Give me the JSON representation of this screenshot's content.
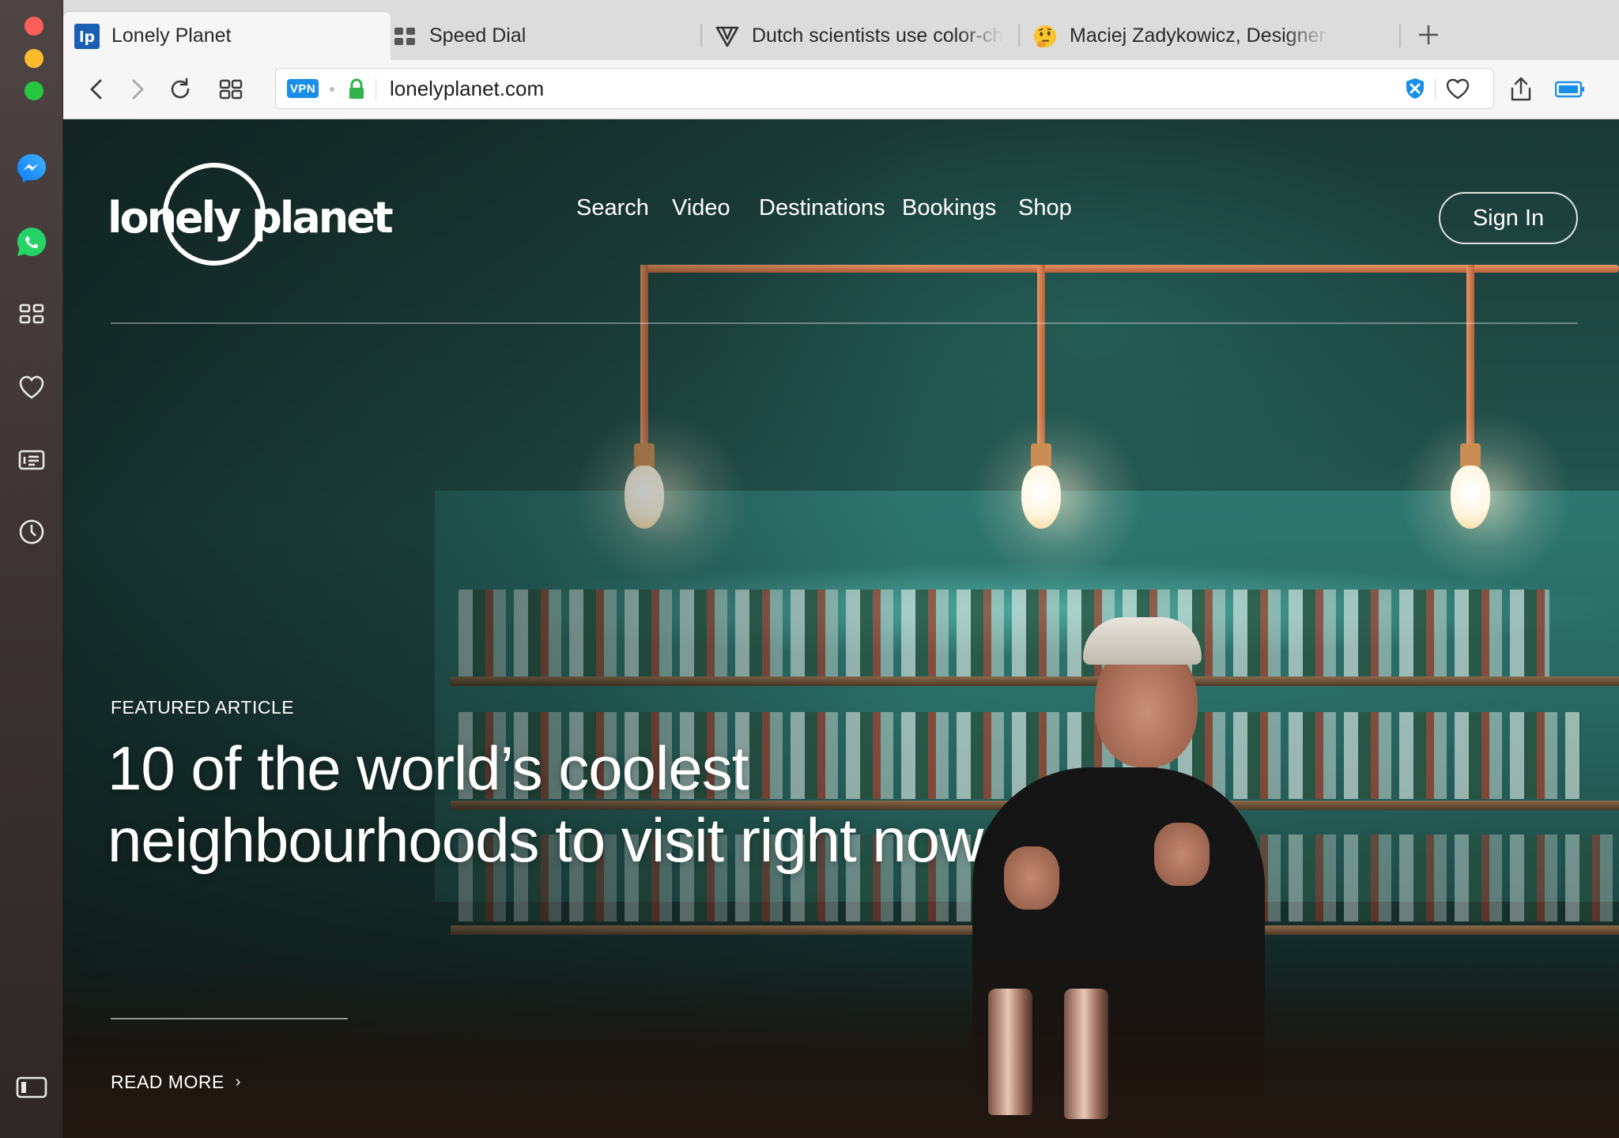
{
  "browser": {
    "tabs": [
      {
        "title": "Lonely Planet",
        "favicon": "lonely-planet-favicon",
        "active": true
      },
      {
        "title": "Speed Dial",
        "favicon": "speed-dial-favicon",
        "active": false
      },
      {
        "title": "Dutch scientists use color-ch",
        "favicon": "verge-favicon",
        "active": false
      },
      {
        "title": "Maciej Zadykowicz, Designer",
        "favicon": "thinking-face-emoji",
        "active": false
      }
    ],
    "favicon_lp_text": "lp",
    "new_tab_icon": "plus-icon",
    "address": {
      "vpn_label": "VPN",
      "url": "lonelyplanet.com",
      "secure_icon": "lock-icon"
    },
    "toolbar_icons": [
      "back-arrow-icon",
      "forward-arrow-icon",
      "reload-icon",
      "grid-icon",
      "adblock-icon",
      "heart-icon",
      "share-icon",
      "battery-icon"
    ]
  },
  "sidebar": {
    "items": [
      "messenger-icon",
      "whatsapp-icon",
      "speed-dial-icon",
      "heart-icon",
      "news-icon",
      "history-icon",
      "sidebar-toggle-icon"
    ]
  },
  "site": {
    "logo_text": "lonely planet",
    "nav": [
      "Search",
      "Video",
      "Destinations",
      "Bookings",
      "Shop"
    ],
    "sign_in": "Sign In",
    "featured_label": "FEATURED ARTICLE",
    "headline": "10 of the world’s coolest neighbourhoods to visit right now",
    "read_more": "READ MORE",
    "read_more_chevron": "›"
  },
  "colors": {
    "vpn_blue": "#1a8fe8",
    "lock_green": "#2fb34a",
    "hero_teal": "#245751",
    "copper": "#d9824f"
  }
}
